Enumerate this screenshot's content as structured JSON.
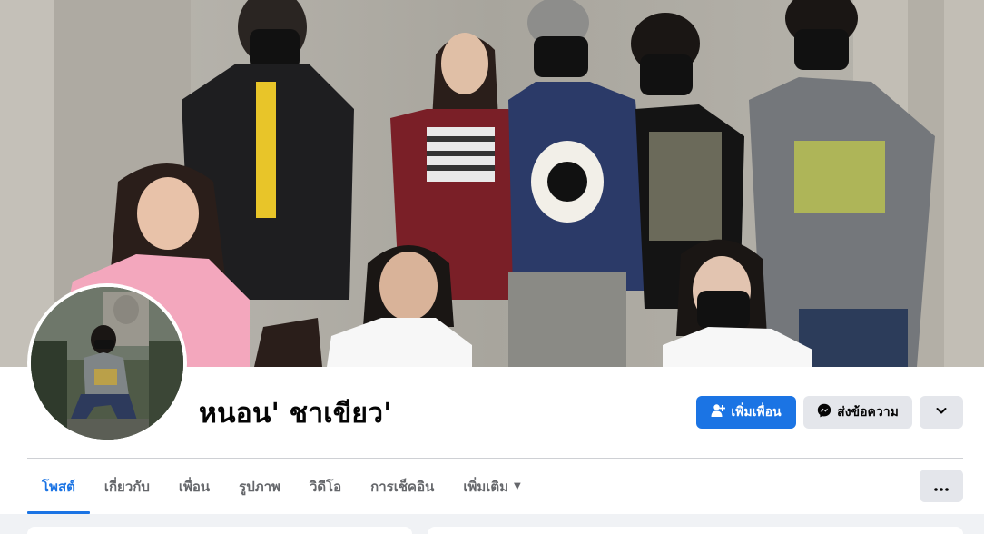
{
  "profile": {
    "name": "หนอน' ชาเขียว'"
  },
  "actions": {
    "add_friend_label": "เพิ่มเพื่อน",
    "message_label": "ส่งข้อความ",
    "add_friend_icon": "person-add-icon",
    "message_icon": "messenger-icon",
    "dropdown_icon": "chevron-down-icon"
  },
  "tabs": [
    {
      "label": "โพสต์",
      "active": true
    },
    {
      "label": "เกี่ยวกับ",
      "active": false
    },
    {
      "label": "เพื่อน",
      "active": false
    },
    {
      "label": "รูปภาพ",
      "active": false
    },
    {
      "label": "วิดีโอ",
      "active": false
    },
    {
      "label": "การเช็คอิน",
      "active": false
    },
    {
      "label": "เพิ่มเติม",
      "active": false
    }
  ],
  "more_menu_icon": "more-horizontal-icon",
  "colors": {
    "accent": "#1b74e4",
    "secondary_button": "#e4e6eb",
    "page_background": "#f0f2f5",
    "text_primary": "#050505",
    "text_secondary": "#65676b"
  }
}
